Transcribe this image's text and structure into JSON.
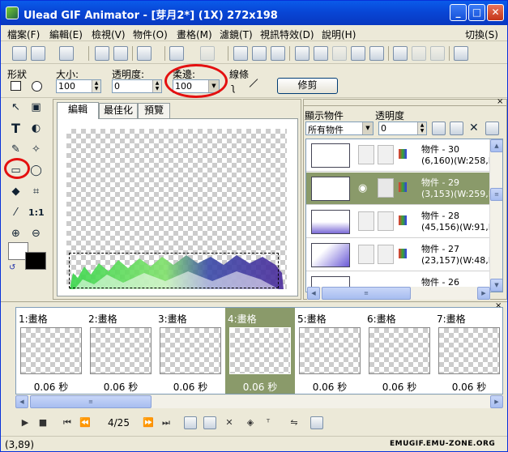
{
  "window": {
    "title": "Ulead GIF Animator - [芽月2*] (1X) 272x198",
    "controls": [
      "minimize-icon",
      "maximize-icon",
      "close-icon"
    ]
  },
  "menu": {
    "items": [
      "檔案(F)",
      "編輯(E)",
      "檢視(V)",
      "物件(O)",
      "畫格(M)",
      "濾鏡(T)",
      "視訊特效(D)",
      "說明(H)"
    ],
    "right": "切換(S)"
  },
  "props": {
    "shape_label": "形狀",
    "size_label": "大小:",
    "size_value": "100",
    "opacity_label": "透明度:",
    "opacity_value": "0",
    "soft_label": "柔邊:",
    "soft_value": "100",
    "line_label": "線條",
    "trim_button": "修剪"
  },
  "editor": {
    "tabs": [
      "編輯",
      "最佳化",
      "預覽"
    ]
  },
  "objects": {
    "show_label": "顯示物件",
    "show_value": "所有物件",
    "opacity_label": "透明度",
    "opacity_value": "0",
    "items": [
      {
        "name": "物件 - 30",
        "info": "(6,160)(W:258,H:"
      },
      {
        "name": "物件 - 29",
        "info": "(3,153)(W:259,H:"
      },
      {
        "name": "物件 - 28",
        "info": "(45,156)(W:91,H:"
      },
      {
        "name": "物件 - 27",
        "info": "(23,157)(W:48,H:"
      },
      {
        "name": "物件 - 26",
        "info": ""
      }
    ]
  },
  "frames": [
    {
      "label": "1:畫格",
      "delay": "0.06 秒"
    },
    {
      "label": "2:畫格",
      "delay": "0.06 秒"
    },
    {
      "label": "3:畫格",
      "delay": "0.06 秒"
    },
    {
      "label": "4:畫格",
      "delay": "0.06 秒"
    },
    {
      "label": "5:畫格",
      "delay": "0.06 秒"
    },
    {
      "label": "6:畫格",
      "delay": "0.06 秒"
    },
    {
      "label": "7:畫格",
      "delay": "0.06 秒"
    }
  ],
  "playback": {
    "frame_counter": "4/25"
  },
  "status": {
    "coords": "(3,89)",
    "watermark": "EMUGIF.EMU-ZONE.ORG"
  },
  "colors": {
    "title_bar": "#0846d6",
    "selection": "#8a9a6a",
    "highlight_ring": "#e41010"
  }
}
